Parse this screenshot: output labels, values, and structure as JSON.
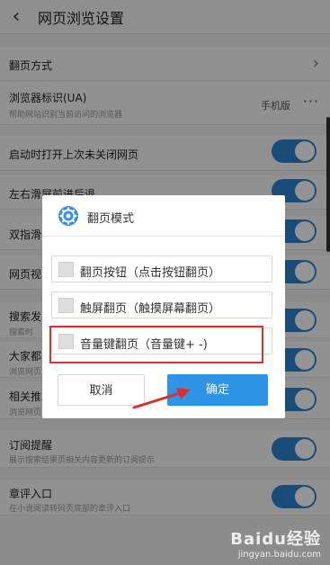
{
  "header": {
    "title": "网页浏览设置"
  },
  "settings": [
    {
      "label": "翻页方式",
      "sub": "",
      "right": "›",
      "type": "arrow"
    },
    {
      "label": "浏览器标识(UA)",
      "sub": "帮助网站识别当前访问的浏览器",
      "right": "手机版",
      "type": "more"
    },
    {
      "label": "启动时打开上次未关闭网页",
      "sub": "",
      "type": "toggle",
      "on": true
    },
    {
      "label": "左右滑屏前进后退",
      "sub": "",
      "type": "toggle",
      "on": true
    },
    {
      "label": "双指滑",
      "sub": "",
      "type": "toggle",
      "on": true
    },
    {
      "label": "网页视",
      "sub": "",
      "type": "toggle",
      "on": true
    },
    {
      "label": "搜索发",
      "sub": "搜索时",
      "type": "toggle",
      "on": true
    },
    {
      "label": "大家都",
      "sub": "浏览网页",
      "type": "toggle",
      "on": true
    },
    {
      "label": "相关推",
      "sub": "浏览网页",
      "type": "toggle",
      "on": true
    },
    {
      "label": "订阅提醒",
      "sub": "展示搜索结果页相关内容更新的订阅提示",
      "type": "toggle",
      "on": true
    },
    {
      "label": "章评入口",
      "sub": "在小说阅读转码页底部的章评入口",
      "type": "toggle",
      "on": true
    }
  ],
  "dialog": {
    "title": "翻页模式",
    "options": [
      {
        "label": "翻页按钮（点击按钮翻页）",
        "checked": false
      },
      {
        "label": "触屏翻页（触摸屏幕翻页）",
        "checked": false
      },
      {
        "label": "音量键翻页（音量键+ -)",
        "checked": false
      }
    ],
    "cancel": "取消",
    "confirm": "确定"
  },
  "colors": {
    "accent": "#2e84d3",
    "confirm": "#2f93e6",
    "highlight": "#d9312f"
  },
  "watermark": {
    "main": "Baidu经验",
    "sub": "jingyan.baidu.com"
  }
}
